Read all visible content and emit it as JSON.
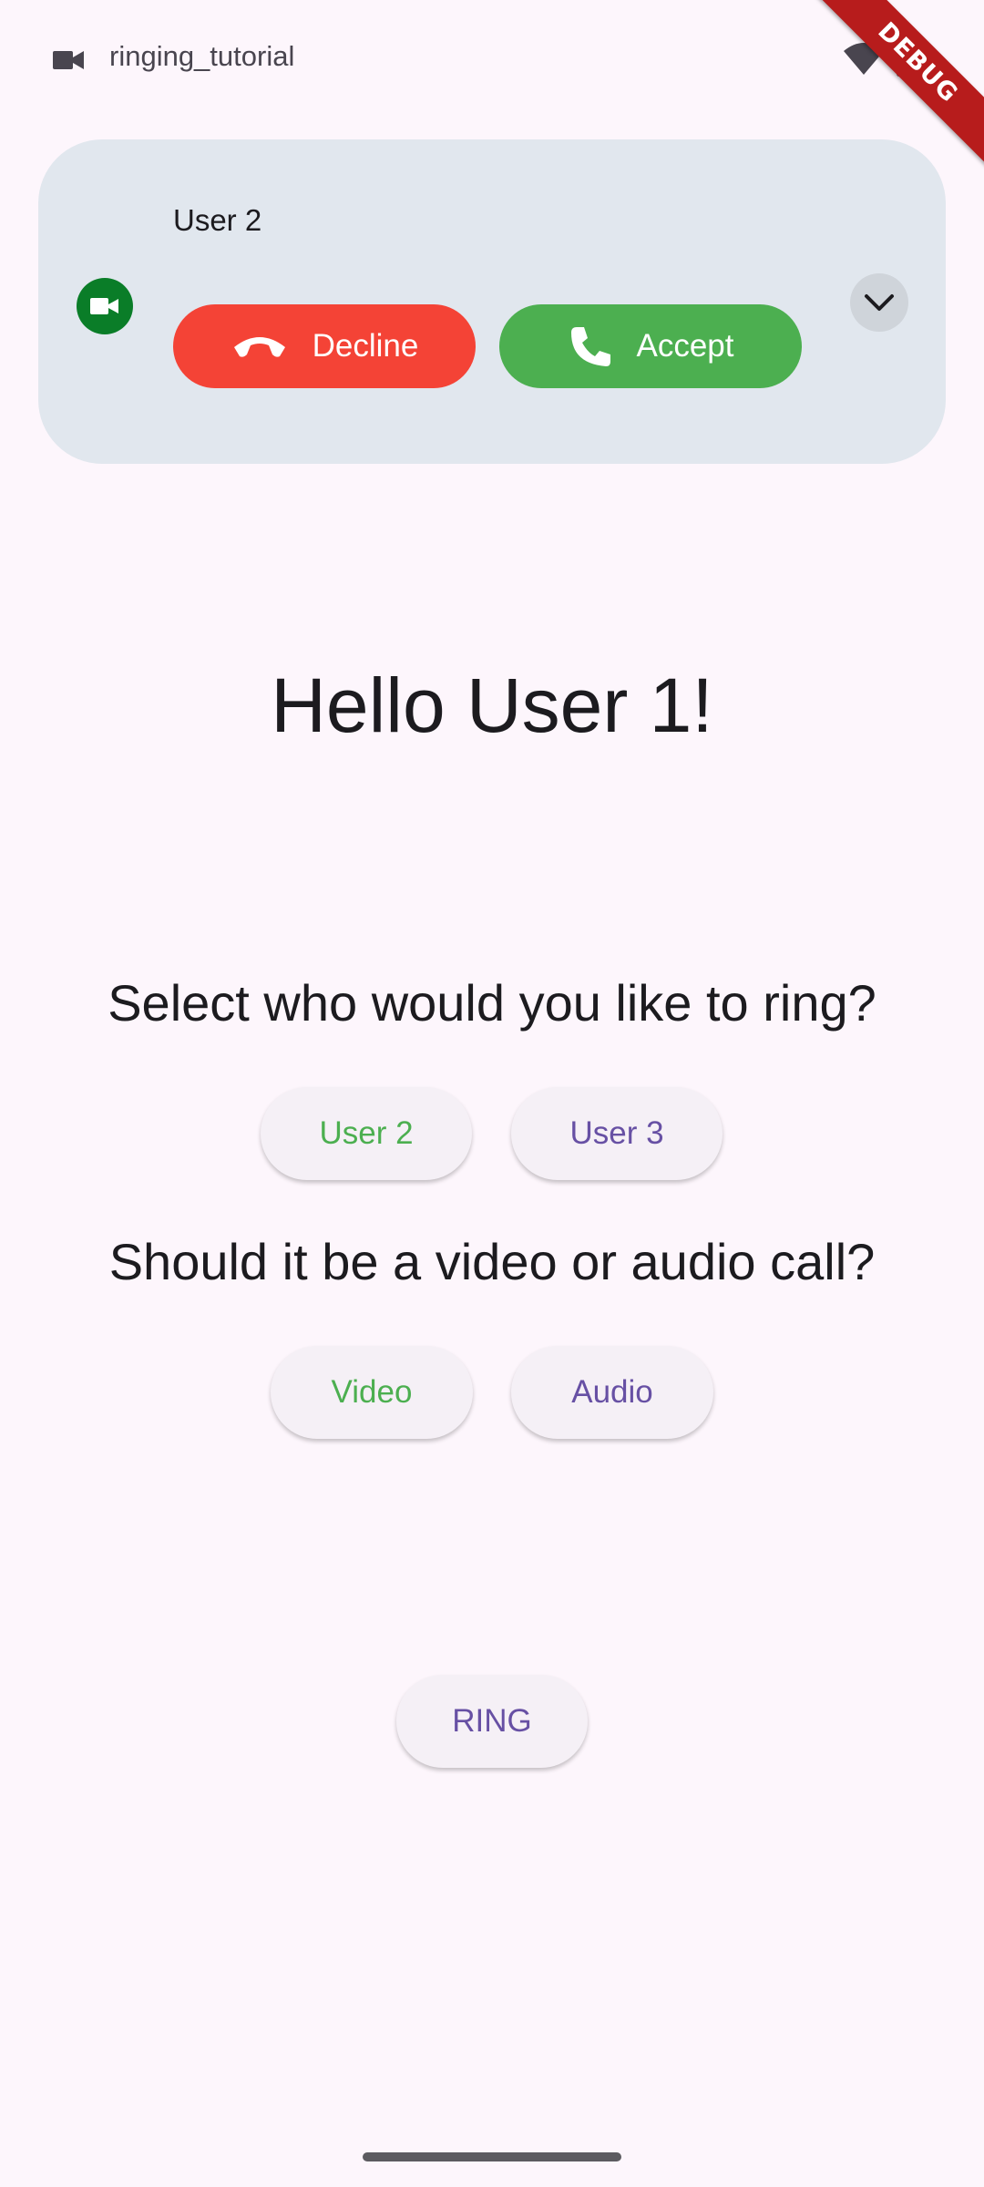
{
  "status_bar": {
    "app_icon": "videocam-icon",
    "app_name": "ringing_tutorial",
    "wifi_icon": "wifi-icon",
    "battery_icon": "battery-charging-icon"
  },
  "debug_banner": {
    "label": "DEBUG",
    "color": "#b71c1c"
  },
  "incoming_call": {
    "app_icon": "videocam-icon",
    "caller_name": "User 2",
    "decline_label": "Decline",
    "accept_label": "Accept",
    "decline_color": "#f44336",
    "accept_color": "#4caf50",
    "expand_icon": "chevron-down-icon"
  },
  "main": {
    "greeting": "Hello User 1!",
    "ring_question": "Select who would you like to ring?",
    "users": [
      {
        "label": "User 2",
        "selected": true
      },
      {
        "label": "User 3",
        "selected": false
      }
    ],
    "call_type_question": "Should it be a video or audio call?",
    "call_types": [
      {
        "label": "Video",
        "selected": true
      },
      {
        "label": "Audio",
        "selected": false
      }
    ],
    "ring_label": "RING",
    "selected_color": "#4caf50",
    "unselected_color": "#6750a4"
  }
}
